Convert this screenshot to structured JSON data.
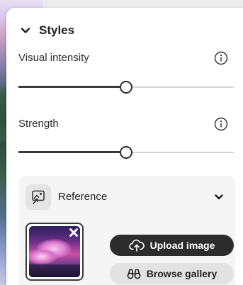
{
  "panel": {
    "title": "Styles"
  },
  "visual_intensity": {
    "label": "Visual intensity",
    "value": 0.5
  },
  "strength": {
    "label": "Strength",
    "value": 0.5
  },
  "reference": {
    "label": "Reference",
    "upload_label": "Upload image",
    "browse_label": "Browse gallery"
  },
  "icons": {
    "header": "chevron-down-icon",
    "info": "info-icon",
    "reference": "image-reference-icon",
    "reference_toggle": "chevron-down-icon",
    "remove": "close-icon",
    "upload": "cloud-upload-icon",
    "browse": "binoculars-icon"
  },
  "colors": {
    "primary_button": "#2c2c2c",
    "secondary_button": "#e2e2e2",
    "slider_fill": "#3a3a3a",
    "slider_track": "#d4d4d4"
  }
}
